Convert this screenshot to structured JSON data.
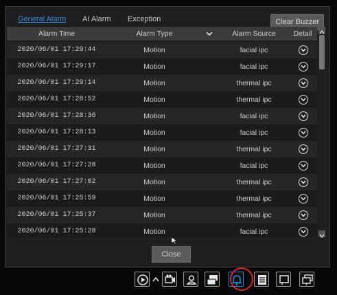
{
  "tabs": [
    {
      "label": "General Alarm",
      "active": true
    },
    {
      "label": "AI Alarm",
      "active": false
    },
    {
      "label": "Exception",
      "active": false
    }
  ],
  "clear_buzzer_label": "Clear Buzzer",
  "table": {
    "columns": [
      "Alarm Time",
      "Alarm Type",
      "Alarm Source",
      "Detail"
    ],
    "rows": [
      {
        "time": "2020/06/01 17:29:44",
        "type": "Motion",
        "source": "facial ipc"
      },
      {
        "time": "2020/06/01 17:29:17",
        "type": "Motion",
        "source": "facial ipc"
      },
      {
        "time": "2020/06/01 17:29:14",
        "type": "Motion",
        "source": "thermal ipc"
      },
      {
        "time": "2020/06/01 17:28:52",
        "type": "Motion",
        "source": "thermal ipc"
      },
      {
        "time": "2020/06/01 17:28:36",
        "type": "Motion",
        "source": "facial ipc"
      },
      {
        "time": "2020/06/01 17:28:13",
        "type": "Motion",
        "source": "facial ipc"
      },
      {
        "time": "2020/06/01 17:27:31",
        "type": "Motion",
        "source": "thermal ipc"
      },
      {
        "time": "2020/06/01 17:27:28",
        "type": "Motion",
        "source": "facial ipc"
      },
      {
        "time": "2020/06/01 17:27:02",
        "type": "Motion",
        "source": "thermal ipc"
      },
      {
        "time": "2020/06/01 17:25:59",
        "type": "Motion",
        "source": "thermal ipc"
      },
      {
        "time": "2020/06/01 17:25:37",
        "type": "Motion",
        "source": "thermal ipc"
      },
      {
        "time": "2020/06/01 17:25:28",
        "type": "Motion",
        "source": "facial ipc"
      }
    ]
  },
  "close_label": "Close",
  "taskbar_icons": [
    "playback-icon",
    "expand-up-icon",
    "record-icon",
    "user-account-icon",
    "camera-channel-icon",
    "alarm-bell-icon",
    "disk-icon",
    "info-icon",
    "multi-screen-icon"
  ],
  "colors": {
    "accent": "#3b8be0",
    "highlight_ring": "#e0242d",
    "panel": "#1e1e1e"
  }
}
